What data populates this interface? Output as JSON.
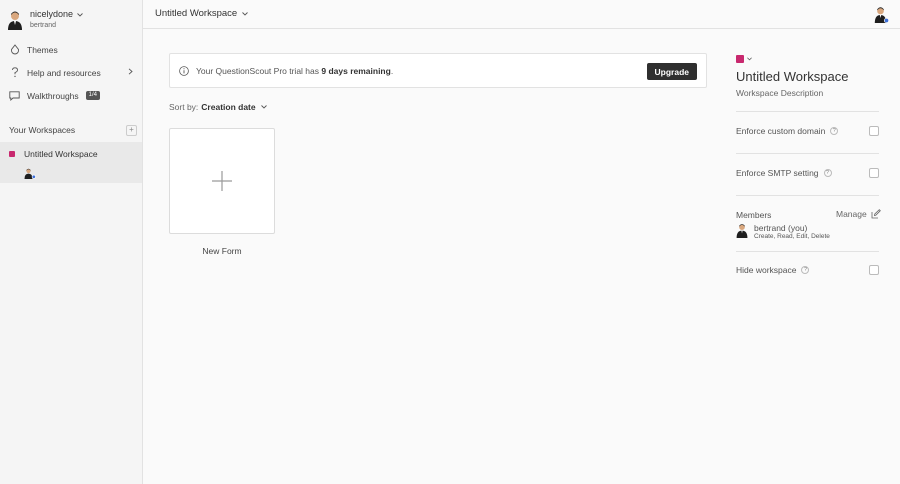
{
  "account": {
    "name": "nicelydone",
    "username": "bertrand"
  },
  "nav": {
    "themes": "Themes",
    "help": "Help and resources",
    "walkthroughs": "Walkthroughs",
    "walkthroughs_badge": "1/4"
  },
  "workspaces": {
    "heading": "Your Workspaces",
    "add_symbol": "+",
    "items": [
      {
        "label": "Untitled Workspace",
        "color": "#c8286e"
      }
    ]
  },
  "topbar": {
    "workspace_title": "Untitled Workspace"
  },
  "trial_banner": {
    "prefix": "Your QuestionScout Pro trial has ",
    "days": "9 days remaining",
    "suffix": ".",
    "upgrade_label": "Upgrade"
  },
  "sort": {
    "label": "Sort by:",
    "value": "Creation date"
  },
  "new_form": {
    "label": "New Form"
  },
  "panel": {
    "workspace_color": "#c8286e",
    "title": "Untitled Workspace",
    "description": "Workspace Description",
    "enforce_domain": "Enforce custom domain",
    "enforce_smtp": "Enforce SMTP setting",
    "members_label": "Members",
    "manage_label": "Manage",
    "member": {
      "name": "bertrand (you)",
      "permissions": "Create, Read, Edit, Delete"
    },
    "hide_workspace": "Hide workspace",
    "help_symbol": "?"
  },
  "icons": {
    "themes": "drop-icon",
    "help": "question-icon",
    "walkthroughs": "chat-icon",
    "info": "info-icon",
    "plus": "plus-icon",
    "edit": "edit-icon"
  }
}
